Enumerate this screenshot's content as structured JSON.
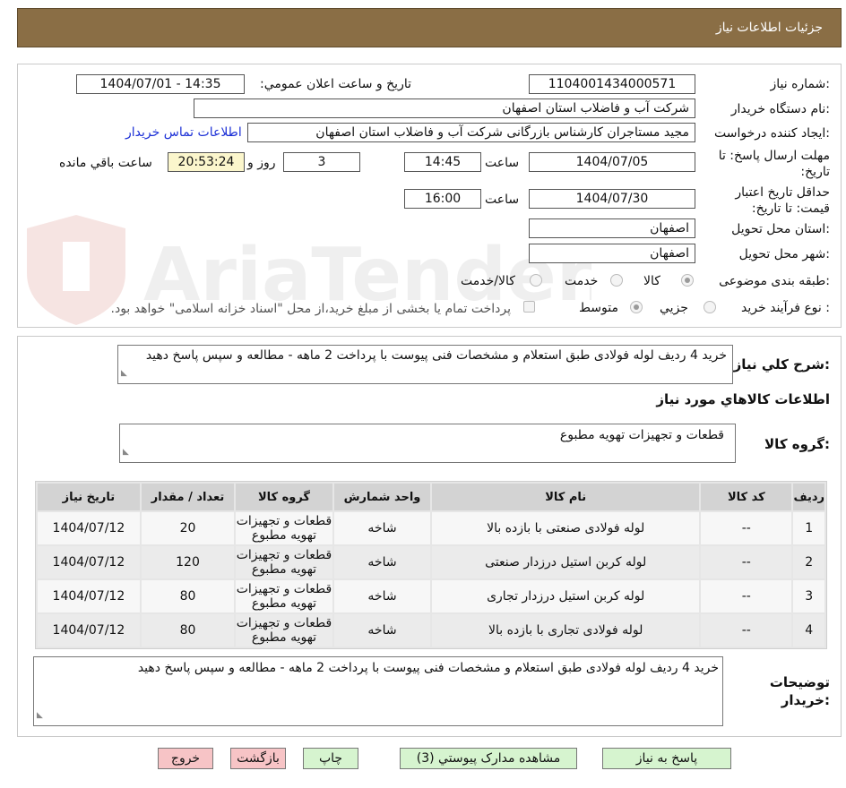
{
  "header": {
    "title": "جزئیات اطلاعات نیاز"
  },
  "form": {
    "need_number_label": "شماره نیاز:",
    "need_number": "1104001434000571",
    "announce_label": "تاریخ و ساعت اعلان عمومي:",
    "announce_value": "1404/07/01 - 14:35",
    "buyer_org_label": "نام دستگاه خريدار:",
    "buyer_org": "شرکت آب و فاضلاب استان اصفهان",
    "creator_label": "ايجاد کننده درخواست:",
    "creator": "مجيد مستاجران کارشناس بازرگانی شرکت آب و فاضلاب استان اصفهان",
    "contact_link": "اطلاعات تماس خريدار",
    "deadline_label": "مهلت ارسال پاسخ: تا تاریخ:",
    "deadline_date": "1404/07/05",
    "time_label": "ساعت",
    "deadline_time": "14:45",
    "days": "3",
    "days_label": "روز و",
    "remaining_time": "20:53:24",
    "remaining_label": "ساعت باقي مانده",
    "validity_label": "حداقل تاریخ اعتبار قیمت: تا تاریخ:",
    "validity_date": "1404/07/30",
    "validity_time": "16:00",
    "province_label": "استان محل تحویل:",
    "province": "اصفهان",
    "city_label": "شهر محل تحویل:",
    "city": "اصفهان",
    "category_label": "طبقه بندی موضوعی:",
    "category_options": [
      "کالا",
      "خدمت",
      "کالا/خدمت"
    ],
    "purchase_type_label": "نوع فرآیند خرید :",
    "purchase_options": [
      "جزيي",
      "متوسط"
    ],
    "payment_note": "پرداخت تمام یا بخشی از مبلغ خرید،از محل \"اسناد خزانه اسلامی\" خواهد بود."
  },
  "description": {
    "label": "شرح کلي نياز:",
    "text": "خرید 4 ردیف لوله فولادی طبق استعلام و مشخصات فنی پیوست با پرداخت 2 ماهه - مطالعه و سپس پاسخ دهید"
  },
  "goods": {
    "section_title": "اطلاعات کالاهاي مورد نياز",
    "group_label": "گروه کالا:",
    "group_value": "قطعات و تجهیزات تهویه مطبوع"
  },
  "table": {
    "headers": [
      "ردیف",
      "کد کالا",
      "نام کالا",
      "واحد شمارش",
      "گروه کالا",
      "تعداد / مقدار",
      "تاریخ نیاز"
    ],
    "rows": [
      [
        "1",
        "--",
        "لوله فولادی صنعتی با بازده بالا",
        "شاخه",
        "قطعات و تجهیزات تهویه مطبوع",
        "20",
        "1404/07/12"
      ],
      [
        "2",
        "--",
        "لوله کربن استیل درزدار صنعتی",
        "شاخه",
        "قطعات و تجهیزات تهویه مطبوع",
        "120",
        "1404/07/12"
      ],
      [
        "3",
        "--",
        "لوله کربن استیل درزدار تجاری",
        "شاخه",
        "قطعات و تجهیزات تهویه مطبوع",
        "80",
        "1404/07/12"
      ],
      [
        "4",
        "--",
        "لوله فولادی تجاری با بازده بالا",
        "شاخه",
        "قطعات و تجهیزات تهویه مطبوع",
        "80",
        "1404/07/12"
      ]
    ]
  },
  "buyer_notes": {
    "label_line1": "توضیحات",
    "label_line2": "خریدار:",
    "text": "خرید 4 ردیف لوله فولادی طبق استعلام و مشخصات فنی پیوست با پرداخت 2 ماهه - مطالعه و سپس پاسخ دهید"
  },
  "buttons": {
    "reply": "پاسخ به نیاز",
    "attachments": "مشاهده مدارک پیوستي (3)",
    "print": "چاپ",
    "back": "بازگشت",
    "exit": "خروج"
  },
  "watermark": {
    "text": "AriaTender.neT"
  },
  "colors": {
    "header_bg": "#8a6e45",
    "green_button": "#d6f4cf",
    "red_button": "#f7c4c6",
    "link": "#1b2fd6",
    "yellow_field": "#fbf6cc"
  }
}
